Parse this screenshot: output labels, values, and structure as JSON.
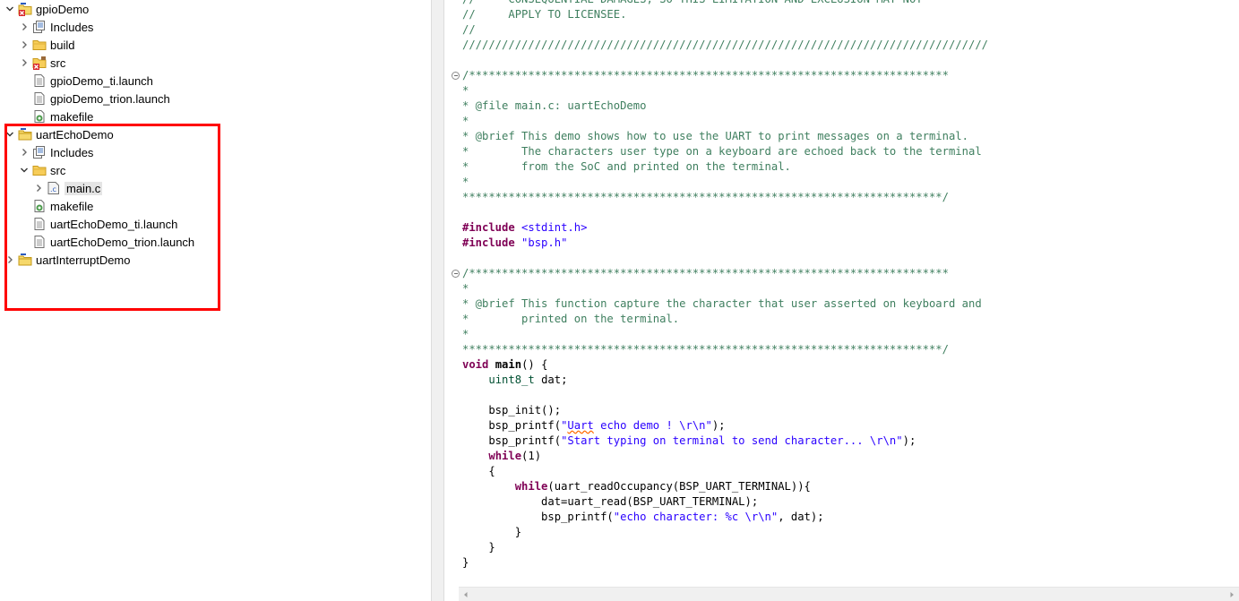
{
  "explorer": {
    "items": [
      {
        "label": "gpioDemo",
        "level": 0,
        "arrow": "expanded",
        "icon": "project-error-icon"
      },
      {
        "label": "Includes",
        "level": 1,
        "arrow": "collapsed",
        "icon": "includes-icon"
      },
      {
        "label": "build",
        "level": 1,
        "arrow": "collapsed",
        "icon": "folder-icon"
      },
      {
        "label": "src",
        "level": 1,
        "arrow": "collapsed",
        "icon": "source-folder-error-icon"
      },
      {
        "label": "gpioDemo_ti.launch",
        "level": 1,
        "arrow": "none",
        "icon": "file-icon"
      },
      {
        "label": "gpioDemo_trion.launch",
        "level": 1,
        "arrow": "none",
        "icon": "file-icon"
      },
      {
        "label": "makefile",
        "level": 1,
        "arrow": "none",
        "icon": "makefile-icon"
      },
      {
        "label": "uartEchoDemo",
        "level": 0,
        "arrow": "expanded",
        "icon": "project-icon"
      },
      {
        "label": "Includes",
        "level": 1,
        "arrow": "collapsed",
        "icon": "includes-icon"
      },
      {
        "label": "src",
        "level": 1,
        "arrow": "expanded",
        "icon": "folder-icon"
      },
      {
        "label": "main.c",
        "level": 2,
        "arrow": "collapsed",
        "icon": "c-file-icon",
        "selected": true
      },
      {
        "label": "makefile",
        "level": 1,
        "arrow": "none",
        "icon": "makefile-icon"
      },
      {
        "label": "uartEchoDemo_ti.launch",
        "level": 1,
        "arrow": "none",
        "icon": "file-icon"
      },
      {
        "label": "uartEchoDemo_trion.launch",
        "level": 1,
        "arrow": "none",
        "icon": "file-icon"
      },
      {
        "label": "uartInterruptDemo",
        "level": 0,
        "arrow": "collapsed",
        "icon": "project-icon"
      }
    ]
  },
  "editor": {
    "lines": [
      [
        [
          "comment",
          "//     CONSEQUENTIAL DAMAGES, SO THIS LIMITATION AND EXCLUSION MAY NOT"
        ]
      ],
      [
        [
          "comment",
          "//     APPLY TO LICENSEE."
        ]
      ],
      [
        [
          "comment",
          "//"
        ]
      ],
      [
        [
          "comment",
          "////////////////////////////////////////////////////////////////////////////////"
        ]
      ],
      [],
      [
        [
          "comment",
          "/*************************************************************************"
        ]
      ],
      [
        [
          "comment",
          "*"
        ]
      ],
      [
        [
          "comment",
          "* @file main.c: uartEchoDemo"
        ]
      ],
      [
        [
          "comment",
          "*"
        ]
      ],
      [
        [
          "comment",
          "* @brief This demo shows how to use the UART to print messages on a terminal."
        ]
      ],
      [
        [
          "comment",
          "*        The characters user type on a keyboard are echoed back to the terminal"
        ]
      ],
      [
        [
          "comment",
          "*        from the SoC and printed on the terminal."
        ]
      ],
      [
        [
          "comment",
          "*"
        ]
      ],
      [
        [
          "comment",
          "*************************************************************************/"
        ]
      ],
      [],
      [
        [
          "kw",
          "#include"
        ],
        [
          "plain",
          " "
        ],
        [
          "str",
          "<stdint.h>"
        ]
      ],
      [
        [
          "kw",
          "#include"
        ],
        [
          "plain",
          " "
        ],
        [
          "str",
          "\"bsp.h\""
        ]
      ],
      [],
      [
        [
          "comment",
          "/*************************************************************************"
        ]
      ],
      [
        [
          "comment",
          "*"
        ]
      ],
      [
        [
          "comment",
          "* @brief This function capture the character that user asserted on keyboard and"
        ]
      ],
      [
        [
          "comment",
          "*        printed on the terminal."
        ]
      ],
      [
        [
          "comment",
          "*"
        ]
      ],
      [
        [
          "comment",
          "*************************************************************************/"
        ]
      ],
      [
        [
          "kw",
          "void"
        ],
        [
          "plain",
          " "
        ],
        [
          "bold",
          "main"
        ],
        [
          "plain",
          "() {"
        ]
      ],
      [
        [
          "plain",
          "    "
        ],
        [
          "type",
          "uint8_t"
        ],
        [
          "plain",
          " dat;"
        ]
      ],
      [],
      [
        [
          "plain",
          "    bsp_init();"
        ]
      ],
      [
        [
          "plain",
          "    bsp_printf("
        ],
        [
          "str",
          "\""
        ],
        [
          "strerr",
          "Uart"
        ],
        [
          "str",
          " echo demo ! \\r\\n\""
        ],
        [
          "plain",
          ");"
        ]
      ],
      [
        [
          "plain",
          "    bsp_printf("
        ],
        [
          "str",
          "\"Start typing on terminal to send character... \\r\\n\""
        ],
        [
          "plain",
          ");"
        ]
      ],
      [
        [
          "plain",
          "    "
        ],
        [
          "kw",
          "while"
        ],
        [
          "plain",
          "(1)"
        ]
      ],
      [
        [
          "plain",
          "    {"
        ]
      ],
      [
        [
          "plain",
          "        "
        ],
        [
          "kw",
          "while"
        ],
        [
          "plain",
          "(uart_readOccupancy(BSP_UART_TERMINAL)){"
        ]
      ],
      [
        [
          "plain",
          "            dat=uart_read(BSP_UART_TERMINAL);"
        ]
      ],
      [
        [
          "plain",
          "            bsp_printf("
        ],
        [
          "str",
          "\"echo character: %c \\r\\n\""
        ],
        [
          "plain",
          ", dat);"
        ]
      ],
      [
        [
          "plain",
          "        }"
        ]
      ],
      [
        [
          "plain",
          "    }"
        ]
      ],
      [
        [
          "plain",
          "}"
        ]
      ]
    ],
    "fold_lines": [
      5,
      18
    ]
  }
}
